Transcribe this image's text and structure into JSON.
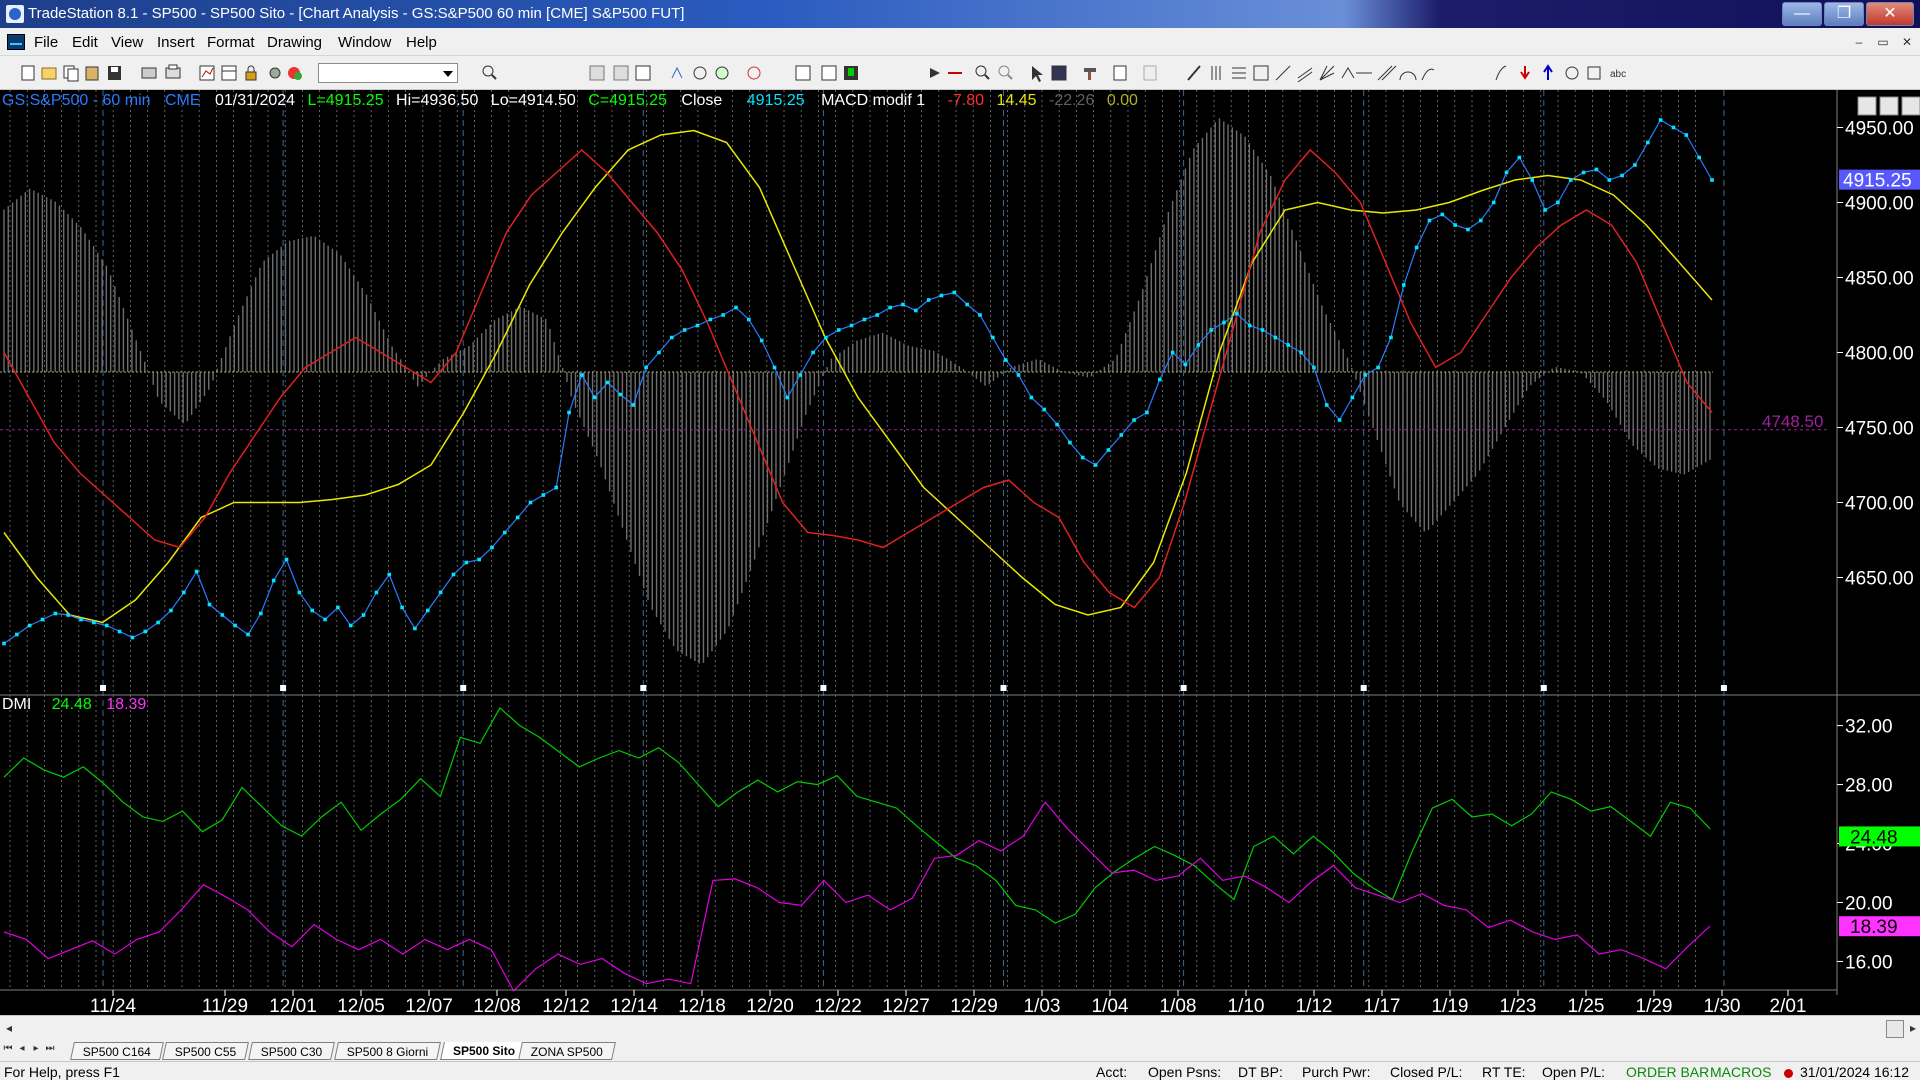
{
  "window": {
    "title": "TradeStation 8.1 - SP500 - SP500 Sito - [Chart Analysis - GS:S&P500  60 min  [CME] S&P500 FUT]",
    "minimize_glyph": "—",
    "restore_glyph": "❐",
    "close_glyph": "✕"
  },
  "menu": {
    "items": [
      "File",
      "Edit",
      "View",
      "Insert",
      "Format",
      "Drawing",
      "Window",
      "Help"
    ],
    "mdi_minimize": "–",
    "mdi_restore": "▭",
    "mdi_close": "✕"
  },
  "chart_header": {
    "symbol": "GS:S&P500 - 60 min",
    "exchange": "CME",
    "date": "01/31/2024",
    "last": "L=4915.25",
    "high": "Hi=4936.50",
    "low": "Lo=4914.50",
    "close_value": "C=4915.25",
    "close_label": "Close",
    "close_price": "4915.25",
    "macd_label": "MACD modif 1",
    "macd_values": [
      "-7.80",
      "14.45",
      "-22.26",
      "0.00"
    ]
  },
  "price_axis": {
    "labels": [
      "4950.00",
      "4900.00",
      "4850.00",
      "4800.00",
      "4750.00",
      "4700.00",
      "4650.00"
    ],
    "values": [
      4950,
      4900,
      4850,
      4800,
      4750,
      4700,
      4650
    ],
    "current_price": "4915.25",
    "reference_level": "4748.50"
  },
  "dmi": {
    "label": "DMI",
    "plus": "24.48",
    "minus": "18.39",
    "axis_labels": [
      "32.00",
      "28.00",
      "24.00",
      "20.00",
      "16.00"
    ],
    "axis_values": [
      32,
      28,
      24,
      20,
      16
    ]
  },
  "time_axis": {
    "labels": [
      "11/24",
      "11/29",
      "12/01",
      "12/05",
      "12/07",
      "12/08",
      "12/12",
      "12/14",
      "12/18",
      "12/20",
      "12/22",
      "12/27",
      "12/29",
      "1/03",
      "1/04",
      "1/08",
      "1/10",
      "1/12",
      "1/17",
      "1/19",
      "1/23",
      "1/25",
      "1/29",
      "1/30",
      "2/01"
    ]
  },
  "tabs": [
    "SP500 C164",
    "SP500 C55",
    "SP500 C30",
    "SP500 8 Giorni",
    "SP500 Sito",
    "ZONA SP500"
  ],
  "active_tab": "SP500 Sito",
  "status": {
    "help": "For Help, press F1",
    "acct": "Acct:",
    "open_psns": "Open Psns:",
    "dt_bp": "DT BP:",
    "purch_pwr": "Purch Pwr:",
    "closed_pl": "Closed P/L:",
    "rt_te": "RT TE:",
    "open_pl": "Open P/L:",
    "order_bar": "ORDER BAR",
    "macros": "MACROS",
    "datetime": "31/01/2024 16:12"
  },
  "colors": {
    "price": "#00e5ff",
    "red_ma": "#e02020",
    "yellow_ma": "#e8e800",
    "histogram": "#7a7a7a",
    "dmi_plus": "#00cc00",
    "dmi_minus": "#e000e0",
    "grid": "#808080"
  },
  "chart_data": [
    {
      "type": "line",
      "panel": "price",
      "y_axis_ticks": [
        4650,
        4700,
        4750,
        4800,
        4850,
        4900,
        4950
      ],
      "reference_levels": [
        4748.5,
        4787
      ],
      "series": [
        {
          "values": [
            4606,
            4612,
            4618,
            4622,
            4626,
            4625,
            4622,
            4620,
            4618,
            4614,
            4610,
            4614,
            4620,
            4628,
            4640,
            4654,
            4632,
            4625,
            4618,
            4612,
            4626,
            4648,
            4662,
            4640,
            4628,
            4622,
            4630,
            4618,
            4625,
            4640,
            4652,
            4630,
            4616,
            4628,
            4640,
            4652,
            4660,
            4662,
            4670,
            4680,
            4690,
            4700,
            4705,
            4710,
            4760,
            4785,
            4770,
            4780,
            4772,
            4765,
            4790,
            4800,
            4810,
            4815,
            4818,
            4822,
            4825,
            4830,
            4822,
            4808,
            4790,
            4770,
            4785,
            4800,
            4810,
            4815,
            4818,
            4822,
            4825,
            4830,
            4832,
            4828,
            4835,
            4838,
            4840,
            4832,
            4825,
            4810,
            4795,
            4785,
            4770,
            4762,
            4752,
            4740,
            4730,
            4725,
            4735,
            4745,
            4755,
            4760,
            4782,
            4800,
            4792,
            4805,
            4815,
            4820,
            4826,
            4818,
            4815,
            4810,
            4805,
            4800,
            4790,
            4765,
            4755,
            4770,
            4785,
            4790,
            4810,
            4845,
            4870,
            4888,
            4892,
            4885,
            4882,
            4888,
            4900,
            4920,
            4930,
            4915,
            4895,
            4900,
            4915,
            4920,
            4922,
            4915,
            4918,
            4925,
            4940,
            4955,
            4950,
            4945,
            4930,
            4915
          ]
        },
        {
          "values": [
            4800,
            4770,
            4740,
            4720,
            4705,
            4690,
            4675,
            4670,
            4690,
            4720,
            4745,
            4770,
            4790,
            4800,
            4810,
            4800,
            4790,
            4780,
            4800,
            4840,
            4880,
            4905,
            4920,
            4935,
            4920,
            4900,
            4880,
            4855,
            4820,
            4780,
            4740,
            4700,
            4680,
            4678,
            4675,
            4670,
            4680,
            4690,
            4700,
            4710,
            4715,
            4700,
            4690,
            4660,
            4640,
            4630,
            4650,
            4700,
            4760,
            4820,
            4880,
            4915,
            4935,
            4920,
            4900,
            4860,
            4820,
            4790,
            4800,
            4825,
            4850,
            4870,
            4885,
            4895,
            4885,
            4860,
            4820,
            4780,
            4760
          ]
        },
        {
          "values": [
            4680,
            4650,
            4625,
            4620,
            4635,
            4660,
            4690,
            4700,
            4700,
            4700,
            4702,
            4705,
            4712,
            4725,
            4760,
            4800,
            4845,
            4880,
            4910,
            4935,
            4945,
            4948,
            4940,
            4910,
            4860,
            4810,
            4770,
            4740,
            4710,
            4690,
            4670,
            4650,
            4632,
            4625,
            4630,
            4660,
            4720,
            4800,
            4860,
            4895,
            4900,
            4895,
            4893,
            4895,
            4900,
            4908,
            4915,
            4918,
            4915,
            4905,
            4885,
            4860,
            4835
          ]
        }
      ]
    },
    {
      "type": "bar",
      "panel": "macd-histogram",
      "zero_level": 4787,
      "series": [
        {
          "values": [
            0.62,
            0.7,
            0.65,
            0.55,
            0.4,
            0.15,
            -0.1,
            -0.18,
            -0.05,
            0.2,
            0.42,
            0.5,
            0.52,
            0.45,
            0.3,
            0.1,
            -0.05,
            0.05,
            0.1,
            0.2,
            0.25,
            0.2,
            -0.1,
            -0.3,
            -0.55,
            -0.8,
            -0.95,
            -1.0,
            -0.88,
            -0.65,
            -0.4,
            -0.15,
            0.05,
            0.12,
            0.15,
            0.1,
            0.08,
            0.02,
            -0.05,
            0.02,
            0.05,
            0.0,
            -0.02,
            0.05,
            0.3,
            0.6,
            0.85,
            0.97,
            0.9,
            0.75,
            0.5,
            0.25,
            0.05,
            -0.2,
            -0.45,
            -0.55,
            -0.45,
            -0.35,
            -0.2,
            -0.05,
            0.02,
            0.0,
            -0.1,
            -0.25,
            -0.33,
            -0.35,
            -0.3
          ]
        }
      ]
    },
    {
      "type": "line",
      "panel": "dmi",
      "y_axis_ticks": [
        16,
        20,
        24,
        28,
        32
      ],
      "series": [
        {
          "values": [
            28.5,
            29.8,
            29.0,
            28.5,
            29.2,
            28.1,
            26.8,
            25.8,
            25.5,
            26.2,
            24.8,
            25.6,
            27.8,
            26.5,
            25.2,
            24.5,
            25.8,
            26.8,
            24.9,
            26.0,
            27.0,
            28.4,
            27.2,
            31.2,
            30.8,
            33.2,
            32.0,
            31.2,
            30.2,
            29.2,
            29.8,
            30.3,
            29.8,
            30.5,
            29.5,
            28.0,
            26.5,
            27.5,
            28.3,
            27.5,
            28.2,
            28.0,
            28.6,
            27.2,
            26.8,
            26.4,
            25.2,
            24.1,
            23.0,
            22.5,
            21.5,
            19.8,
            19.5,
            18.6,
            19.2,
            21.0,
            22.1,
            23.0,
            23.8,
            23.2,
            22.5,
            21.3,
            20.2,
            23.8,
            24.5,
            23.3,
            24.5,
            23.4,
            22.0,
            21.0,
            20.2,
            23.5,
            26.4,
            27.0,
            25.8,
            26.0,
            25.2,
            26.0,
            27.5,
            27.0,
            26.2,
            26.5,
            25.5,
            24.5,
            26.8,
            26.4,
            25.0
          ]
        },
        {
          "values": [
            18.0,
            17.5,
            16.2,
            16.8,
            17.4,
            16.5,
            17.5,
            18.0,
            19.5,
            21.2,
            20.4,
            19.5,
            18.0,
            17.0,
            18.5,
            17.5,
            16.8,
            17.5,
            16.5,
            17.5,
            16.8,
            17.5,
            16.8,
            14.0,
            15.5,
            16.5,
            15.8,
            16.2,
            15.2,
            14.5,
            14.8,
            14.5,
            21.5,
            21.6,
            21.0,
            20.0,
            19.8,
            21.5,
            20.0,
            20.5,
            19.5,
            20.3,
            23.0,
            23.2,
            24.2,
            23.5,
            24.5,
            26.8,
            25.0,
            23.5,
            22.0,
            22.2,
            21.5,
            21.8,
            23.0,
            21.5,
            21.8,
            21.0,
            20.0,
            21.4,
            22.5,
            21.0,
            20.5,
            20.0,
            20.6,
            19.8,
            19.5,
            18.3,
            18.8,
            18.0,
            17.5,
            17.8,
            16.5,
            16.8,
            16.2,
            15.5,
            17.0,
            18.4
          ]
        }
      ]
    }
  ]
}
